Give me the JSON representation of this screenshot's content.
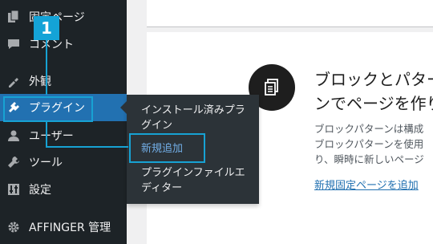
{
  "sidebar": {
    "items": [
      {
        "name": "pages",
        "label": "固定ページ",
        "icon": "pages-icon"
      },
      {
        "name": "comments",
        "label": "コメント",
        "icon": "comments-icon"
      },
      {
        "name": "appearance",
        "label": "外観",
        "icon": "appearance-icon"
      },
      {
        "name": "plugins",
        "label": "プラグイン",
        "icon": "plugins-icon",
        "active": true
      },
      {
        "name": "users",
        "label": "ユーザー",
        "icon": "users-icon"
      },
      {
        "name": "tools",
        "label": "ツール",
        "icon": "tools-icon"
      },
      {
        "name": "settings",
        "label": "設定",
        "icon": "settings-icon"
      },
      {
        "name": "affinger",
        "label": "AFFINGER 管理",
        "icon": "gear-icon"
      }
    ]
  },
  "flyout": {
    "items": [
      {
        "label": "インストール済みプラグイン"
      },
      {
        "label": "新規追加",
        "current": true
      },
      {
        "label": "プラグインファイルエディター"
      }
    ]
  },
  "main": {
    "heading": "ブロックとパターンでページを作りましょう",
    "desc_line1": "ブロックパターンは構成",
    "desc_line2": "ブロックパターンを使用",
    "desc_line3": "り、瞬時に新しいページ",
    "link": "新規固定ページを追加"
  },
  "annotation": {
    "step": "1",
    "color": "#17a2d3"
  },
  "colors": {
    "sidebar_bg": "#1d2327",
    "active_bg": "#2271b1",
    "link": "#2271b1"
  }
}
